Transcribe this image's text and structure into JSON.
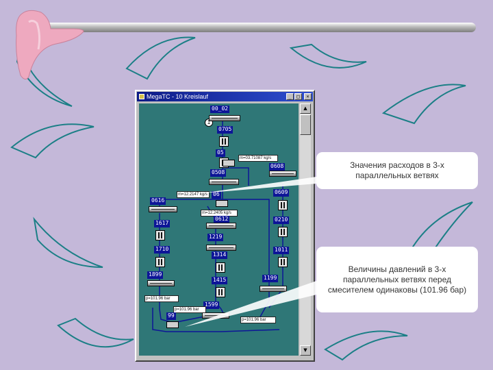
{
  "window": {
    "title": "MegaTC - 10 Kreislauf",
    "minimize_glyph": "_",
    "maximize_glyph": "□",
    "close_glyph": "×",
    "scroll_up_glyph": "▲",
    "scroll_down_glyph": "▼"
  },
  "diagram": {
    "node_badge": "1",
    "labels": {
      "l00_02": "00_02",
      "l0705": "0705",
      "l05": "05",
      "l0508": "0508",
      "l0608": "0608",
      "l0616": "0616",
      "l0609": "0609",
      "l06": "06",
      "l0612": "0612",
      "l1617": "1617",
      "l0210": "0210",
      "l1219": "1219",
      "l1710": "1710",
      "l1011": "1011",
      "l1314": "1314",
      "l1899": "1899",
      "l1415": "1415",
      "l1199": "1199",
      "l1599": "1599",
      "l99": "99"
    },
    "info_boxes": {
      "flow_main": "m=03.71087 kg/s",
      "flow_branch1": "m=12.2147 kg/s",
      "flow_branch2": "m=12.2405 kg/s",
      "pressure_left": "p=101.96 bar",
      "pressure_center": "p=101.96 bar",
      "pressure_right": "p=101.96 bar"
    }
  },
  "callouts": {
    "flows": "Значения расходов в 3-х параллельных ветвях",
    "pressures": "Величины давлений в 3-х параллельных ветвях перед смесителем одинаковы (101.96 бар)"
  },
  "colors": {
    "background": "#c4b8d9",
    "canvas": "#2f7777",
    "label_bg": "#0d1597",
    "pipe_line": "#0d1597",
    "boomerang_pink": "#eea9bf",
    "boomerang_teal": "#55b3b9"
  }
}
